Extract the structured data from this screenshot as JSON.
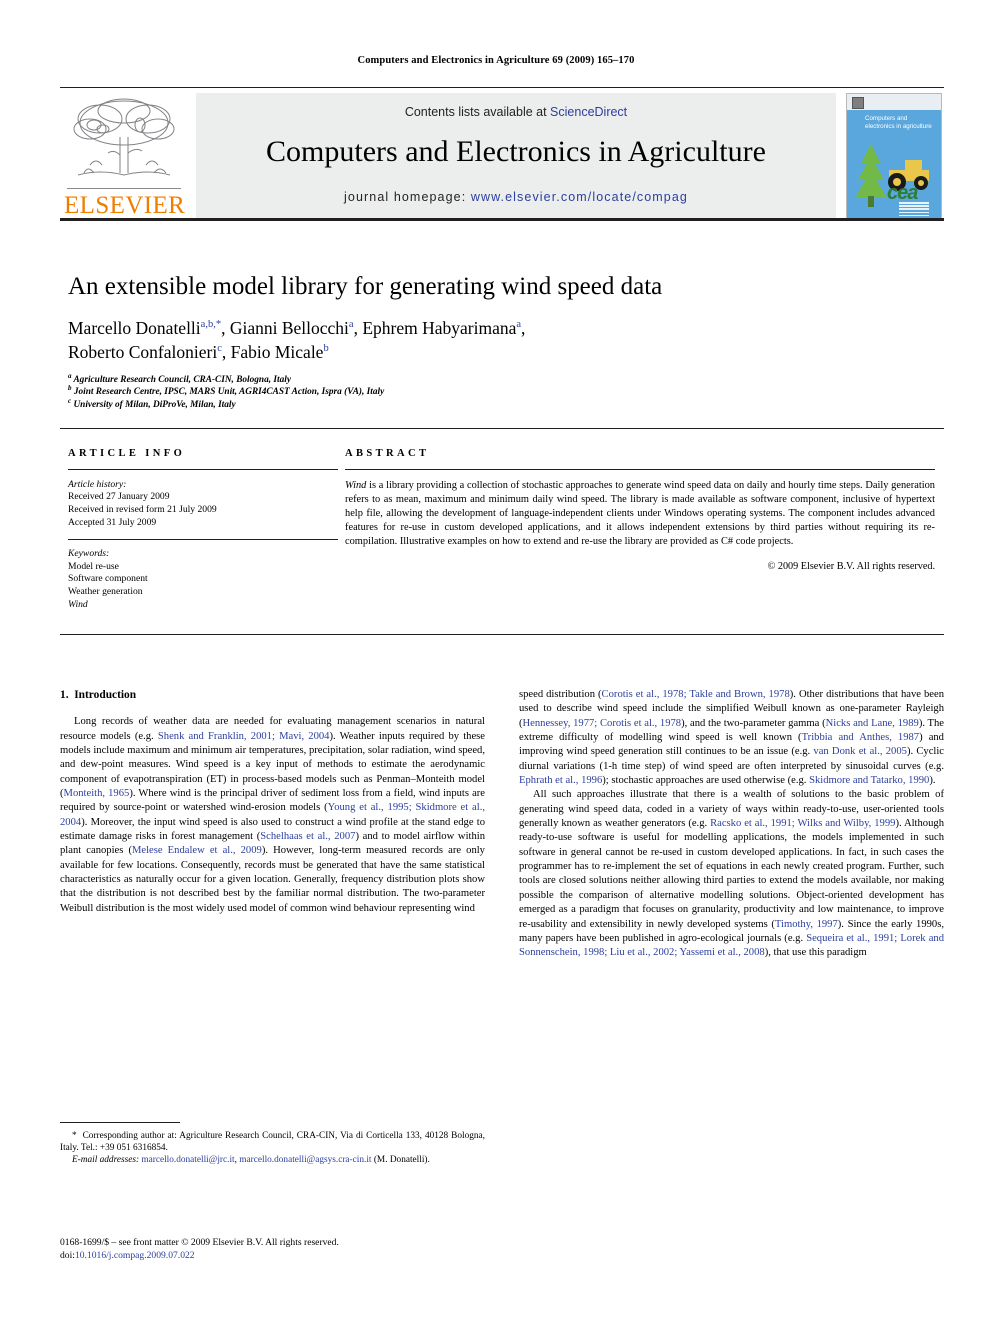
{
  "running_head": "Computers and Electronics in Agriculture 69 (2009) 165–170",
  "masthead": {
    "contents_prefix": "Contents lists available at ",
    "sciencedirect": "ScienceDirect",
    "journal_title": "Computers and Electronics in Agriculture",
    "homepage_label": "journal homepage: ",
    "homepage_url": "www.elsevier.com/locate/compag",
    "publisher": "ELSEVIER",
    "cover_title": "Computers and electronics in agriculture",
    "cover_mark": "cea",
    "accent_blue": "#2b3f9e",
    "elsevier_orange": "#ef7d00",
    "cover_background": "#5aa7dd"
  },
  "title_block": {
    "title": "An extensible model library for generating wind speed data",
    "authors_line1_a": "Marcello Donatelli",
    "authors_line1_a_sup": "a,b,",
    "authors_line1_b": ", Gianni Bellocchi",
    "authors_line1_b_sup": "a",
    "authors_line1_c": ", Ephrem Habyarimana",
    "authors_line1_c_sup": "a",
    "authors_line1_d": ",",
    "authors_line2_a": "Roberto Confalonieri",
    "authors_line2_a_sup": "c",
    "authors_line2_b": ", Fabio Micale",
    "authors_line2_b_sup": "b",
    "affiliations": [
      {
        "mark": "a",
        "text": "Agriculture Research Council, CRA-CIN, Bologna, Italy"
      },
      {
        "mark": "b",
        "text": "Joint Research Centre, IPSC, MARS Unit, AGRI4CAST Action, Ispra (VA), Italy"
      },
      {
        "mark": "c",
        "text": "University of Milan, DiProVe, Milan, Italy"
      }
    ]
  },
  "article_info": {
    "heading": "ARTICLE INFO",
    "history_label": "Article history:",
    "history": [
      "Received 27 January 2009",
      "Received in revised form 21 July 2009",
      "Accepted 31 July 2009"
    ],
    "keywords_label": "Keywords:",
    "keywords": [
      "Model re-use",
      "Software component",
      "Weather generation",
      "Wind"
    ]
  },
  "abstract": {
    "heading": "ABSTRACT",
    "lead_italic": "Wind",
    "text": " is a library providing a collection of stochastic approaches to generate wind speed data on daily and hourly time steps. Daily generation refers to as mean, maximum and minimum daily wind speed. The library is made available as software component, inclusive of hypertext help file, allowing the development of language-independent clients under Windows operating systems. The component includes advanced features for re-use in custom developed applications, and it allows independent extensions by third parties without requiring its re-compilation. Illustrative examples on how to extend and re-use the library are provided as C# code projects.",
    "copyright": "© 2009 Elsevier B.V. All rights reserved."
  },
  "body": {
    "section_number": "1.",
    "section_title": "Introduction",
    "left_para1_part1": "Long records of weather data are needed for evaluating management scenarios in natural resource models (e.g. ",
    "left_ref1": "Shenk and Franklin, 2001; Mavi, 2004",
    "left_para1_part2": "). Weather inputs required by these models include maximum and minimum air temperatures, precipitation, solar radiation, wind speed, and dew-point measures. Wind speed is a key input of methods to estimate the aerodynamic component of evapotranspiration (ET) in process-based models such as Penman–Monteith model (",
    "left_ref2": "Monteith, 1965",
    "left_para1_part3": "). Where wind is the principal driver of sediment loss from a field, wind inputs are required by source-point or watershed wind-erosion models (",
    "left_ref3": "Young et al., 1995; Skidmore et al., 2004",
    "left_para1_part4": "). Moreover, the input wind speed is also used to construct a wind profile at the stand edge to estimate damage risks in forest management (",
    "left_ref4": "Schelhaas et al., 2007",
    "left_para1_part5": ") and to model airflow within plant canopies (",
    "left_ref5": "Melese Endalew et al., 2009",
    "left_para1_part6": "). However, long-term measured records are only available for few locations. Consequently, records must be generated that have the same statistical characteristics as naturally occur for a given location. Generally, frequency distribution plots show that the distribution is not described best by the familiar normal distribution. The two-parameter Weibull distribution is the most widely used model of common wind behaviour representing wind ",
    "right_para1_part1": "speed distribution (",
    "right_ref1": "Corotis et al., 1978; Takle and Brown, 1978",
    "right_para1_part2": "). Other distributions that have been used to describe wind speed include the simplified Weibull known as one-parameter Rayleigh (",
    "right_ref2": "Hennessey, 1977; Corotis et al., 1978",
    "right_para1_part3": "), and the two-parameter gamma (",
    "right_ref3": "Nicks and Lane, 1989",
    "right_para1_part4": "). The extreme difficulty of modelling wind speed is well known (",
    "right_ref4": "Tribbia and Anthes, 1987",
    "right_para1_part5": ") and improving wind speed generation still continues to be an issue (e.g. ",
    "right_ref5": "van Donk et al., 2005",
    "right_para1_part6": "). Cyclic diurnal variations (1-h time step) of wind speed are often interpreted by sinusoidal curves (e.g. ",
    "right_ref6": "Ephrath et al., 1996",
    "right_para1_part7": "); stochastic approaches are used otherwise (e.g. ",
    "right_ref7": "Skidmore and Tatarko, 1990",
    "right_para1_part8": ").",
    "right_para2_part1": "All such approaches illustrate that there is a wealth of solutions to the basic problem of generating wind speed data, coded in a variety of ways within ready-to-use, user-oriented tools generally known as weather generators (e.g. ",
    "right_ref8": "Racsko et al., 1991; Wilks and Wilby, 1999",
    "right_para2_part2": "). Although ready-to-use software is useful for modelling applications, the models implemented in such software in general cannot be re-used in custom developed applications. In fact, in such cases the programmer has to re-implement the set of equations in each newly created program. Further, such tools are closed solutions neither allowing third parties to extend the models available, nor making possible the comparison of alternative modelling solutions. Object-oriented development has emerged as a paradigm that focuses on granularity, productivity and low maintenance, to improve re-usability and extensibility in newly developed systems (",
    "right_ref9": "Timothy, 1997",
    "right_para2_part3": "). Since the early 1990s, many papers have been published in agro-ecological journals (e.g. ",
    "right_ref10": "Sequeira et al., 1991; Lorek and Sonnenschein, 1998; Liu et al., 2002; Yassemi et al., 2008",
    "right_para2_part4": "), that use this paradigm"
  },
  "footnotes": {
    "corresponding_mark": "*",
    "corresponding": "Corresponding author at: Agriculture Research Council, CRA-CIN, Via di Corticella 133, 40128 Bologna, Italy. Tel.: +39 051 6316854.",
    "email_label": "E-mail addresses:",
    "email_1": "marcello.donatelli@jrc.it",
    "email_sep": ", ",
    "email_2": "marcello.donatelli@agsys.cra-cin.it",
    "email_owner": "(M. Donatelli)."
  },
  "imprint": {
    "line1": "0168-1699/$ – see front matter © 2009 Elsevier B.V. All rights reserved.",
    "doi_label": "doi:",
    "doi_value": "10.1016/j.compag.2009.07.022"
  }
}
